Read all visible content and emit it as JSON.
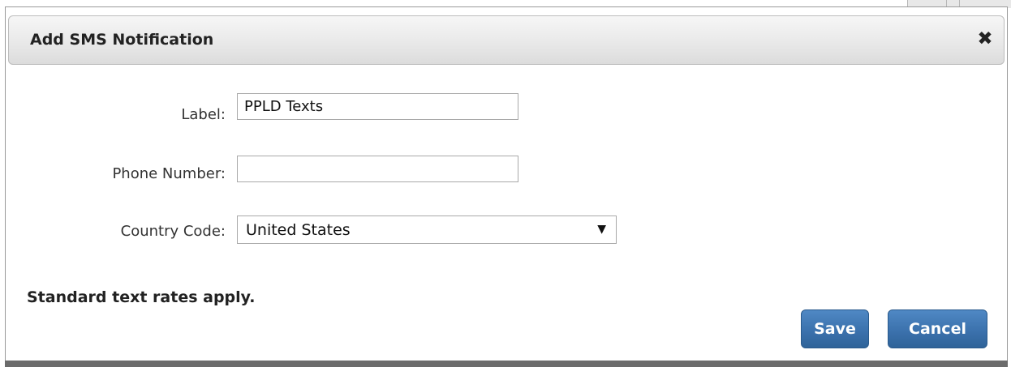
{
  "dialog": {
    "title": "Add SMS Notification",
    "close_icon": "close-icon"
  },
  "form": {
    "label_field": {
      "label": "Label:",
      "value": "PPLD Texts"
    },
    "phone_field": {
      "label": "Phone Number:",
      "value": ""
    },
    "country_field": {
      "label": "Country Code:",
      "selected": "United States",
      "arrow": "▼"
    }
  },
  "notice": "Standard text rates apply.",
  "buttons": {
    "save": "Save",
    "cancel": "Cancel"
  },
  "colors": {
    "button_blue": "#3a70ab",
    "title_bar": "#e9e9e9"
  }
}
